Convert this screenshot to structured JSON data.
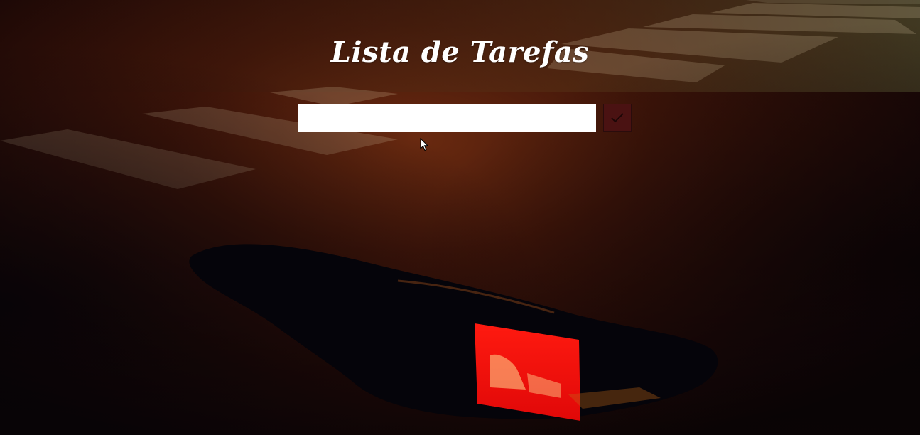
{
  "app": {
    "title": "Lista de Tarefas"
  },
  "form": {
    "input_value": "",
    "input_placeholder": "",
    "submit_icon": "checkmark-icon"
  },
  "colors": {
    "submit_bg": "#4a1212",
    "input_bg": "#ffffff",
    "title_color": "#ffffff"
  }
}
